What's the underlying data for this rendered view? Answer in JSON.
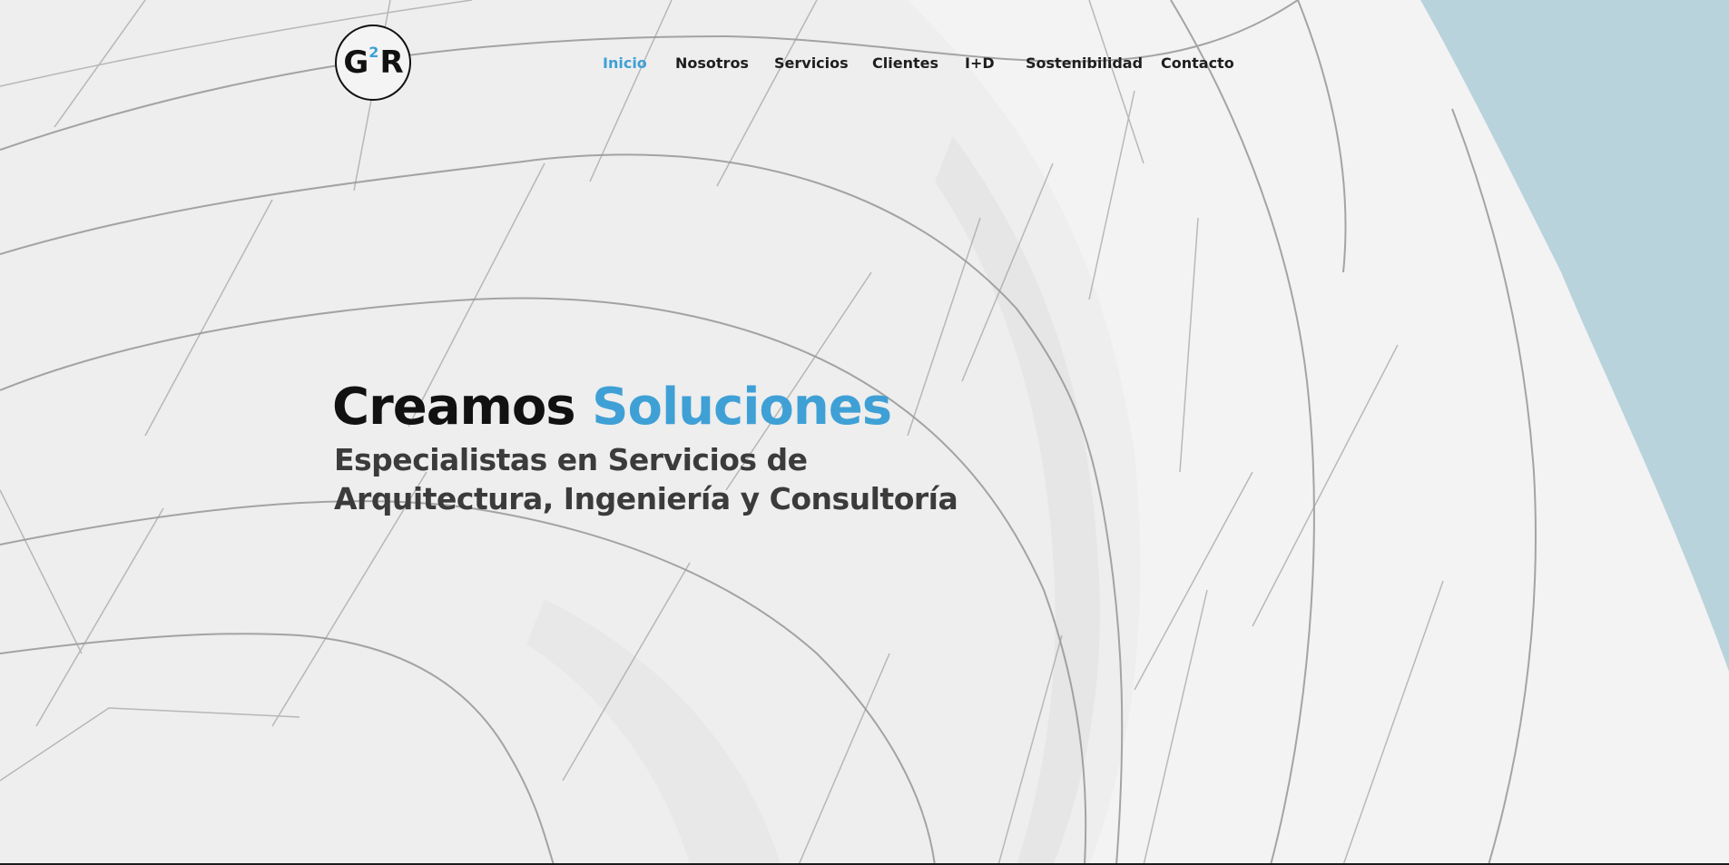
{
  "colors": {
    "accent": "#3fa0d6",
    "text": "#1e1e1e",
    "sky": "#b9d3dc"
  },
  "logo": {
    "letter_left": "G",
    "superscript": "2",
    "letter_right": "R"
  },
  "nav": {
    "items": [
      {
        "label": "Inicio",
        "active": true
      },
      {
        "label": "Nosotros"
      },
      {
        "label": "Servicios"
      },
      {
        "label": "Clientes"
      },
      {
        "label": "I+D"
      },
      {
        "label": "Sostenibilidad"
      },
      {
        "label": "Contacto"
      }
    ]
  },
  "hero": {
    "title_main": "Creamos",
    "title_accent": "Soluciones",
    "subtitle_line1": "Especialistas en Servicios de",
    "subtitle_line2": "Arquitectura, Ingeniería y Consultoría"
  }
}
